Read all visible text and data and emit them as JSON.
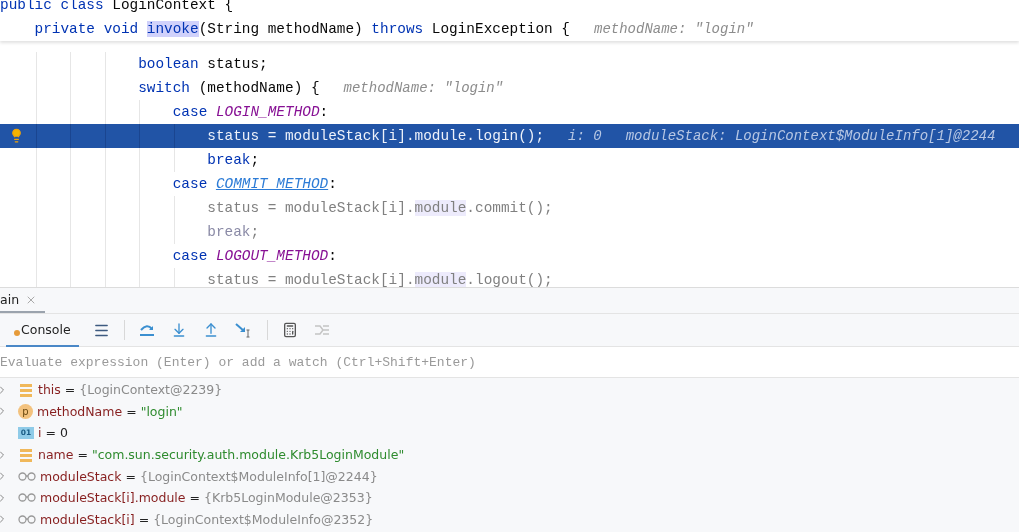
{
  "editor": {
    "sticky_lines": [
      {
        "tokens": [
          {
            "kind": "kw",
            "text": "public class "
          },
          {
            "kind": "text",
            "text": "LoginContext {"
          }
        ]
      },
      {
        "tokens": [
          {
            "kind": "kw",
            "text": "    private void "
          },
          {
            "kind": "sel",
            "text": "invoke"
          },
          {
            "kind": "text",
            "text": "(String methodName) "
          },
          {
            "kind": "kw",
            "text": "throws "
          },
          {
            "kind": "text",
            "text": "LoginException {"
          }
        ],
        "hints": [
          "methodName: \"login\""
        ]
      }
    ],
    "lines": [
      {
        "selected": false,
        "dimmed": false,
        "tokens": [
          {
            "kind": "kw",
            "text": "                boolean "
          },
          {
            "kind": "text",
            "text": "status;"
          }
        ]
      },
      {
        "selected": false,
        "dimmed": false,
        "tokens": [
          {
            "kind": "kw",
            "text": "                switch "
          },
          {
            "kind": "text",
            "text": "(methodName) {"
          }
        ],
        "hints": [
          "methodName: \"login\""
        ]
      },
      {
        "selected": false,
        "dimmed": false,
        "tokens": [
          {
            "kind": "kw",
            "text": "                    case "
          },
          {
            "kind": "const",
            "text": "LOGIN_METHOD"
          },
          {
            "kind": "text",
            "text": ":"
          }
        ]
      },
      {
        "selected": true,
        "dimmed": false,
        "tokens": [
          {
            "kind": "text",
            "text": "                        status = moduleStack[i].module.login();"
          }
        ],
        "hints": [
          "i: 0",
          "moduleStack: LoginContext$ModuleInfo[1]@2244"
        ]
      },
      {
        "selected": false,
        "dimmed": false,
        "tokens": [
          {
            "kind": "kw",
            "text": "                        break"
          },
          {
            "kind": "text",
            "text": ";"
          }
        ]
      },
      {
        "selected": false,
        "dimmed": false,
        "tokens": [
          {
            "kind": "kw",
            "text": "                    case "
          },
          {
            "kind": "link",
            "text": "COMMIT_METHOD"
          },
          {
            "kind": "text",
            "text": ":"
          }
        ]
      },
      {
        "selected": false,
        "dimmed": true,
        "tokens": [
          {
            "kind": "text",
            "text": "                        status = moduleStack[i]."
          },
          {
            "kind": "ref",
            "text": "module"
          },
          {
            "kind": "text",
            "text": ".commit();"
          }
        ]
      },
      {
        "selected": false,
        "dimmed": true,
        "tokens": [
          {
            "kind": "kw",
            "text": "                        break"
          },
          {
            "kind": "text",
            "text": ";"
          }
        ]
      },
      {
        "selected": false,
        "dimmed": false,
        "tokens": [
          {
            "kind": "kw",
            "text": "                    case "
          },
          {
            "kind": "const",
            "text": "LOGOUT_METHOD"
          },
          {
            "kind": "text",
            "text": ":"
          }
        ]
      },
      {
        "selected": false,
        "dimmed": true,
        "tokens": [
          {
            "kind": "text",
            "text": "                        status = moduleStack[i]."
          },
          {
            "kind": "ref",
            "text": "module"
          },
          {
            "kind": "text",
            "text": ".logout();"
          }
        ]
      }
    ]
  },
  "debugger": {
    "session_tab": {
      "label": "ain"
    },
    "tabs": [
      {
        "label": "Console",
        "selected": true
      }
    ],
    "evaluate": {
      "placeholder": "Evaluate expression (Enter) or add a watch (Ctrl+Shift+Enter)"
    },
    "variables": [
      {
        "kind": "field",
        "expandable": true,
        "name": "this",
        "operator": "=",
        "value": "{LoginContext@2239}",
        "color": "#8a8a8a"
      },
      {
        "kind": "param",
        "expandable": true,
        "name": "methodName",
        "operator": "=",
        "value": "\"login\"",
        "color": "#2e8b2e",
        "icon_text": "p"
      },
      {
        "kind": "primitive",
        "expandable": false,
        "name": "i",
        "operator": "=",
        "value": "0",
        "color": "#222222",
        "icon_text": "01"
      },
      {
        "kind": "field",
        "expandable": true,
        "name": "name",
        "operator": "=",
        "value": "\"com.sun.security.auth.module.Krb5LoginModule\"",
        "color": "#2e8b2e"
      },
      {
        "kind": "watch",
        "expandable": true,
        "name": "moduleStack",
        "operator": "=",
        "value": "{LoginContext$ModuleInfo[1]@2244}",
        "color": "#8a8a8a"
      },
      {
        "kind": "watch",
        "expandable": true,
        "name": "moduleStack[i].module",
        "operator": "=",
        "value": "{Krb5LoginModule@2353}",
        "color": "#8a8a8a"
      },
      {
        "kind": "watch",
        "expandable": true,
        "name": "moduleStack[i]",
        "operator": "=",
        "value": "{LoginContext$ModuleInfo@2352}",
        "color": "#8a8a8a"
      }
    ]
  }
}
